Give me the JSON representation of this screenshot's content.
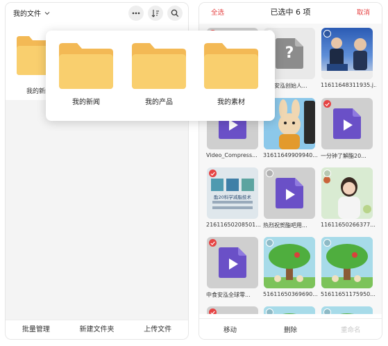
{
  "left_panel": {
    "title": "我的文件",
    "folder_label": "我的新闻",
    "bottom": [
      "批量管理",
      "新建文件夹",
      "上传文件"
    ]
  },
  "popup": {
    "folders": [
      "我的新闻",
      "我的产品",
      "我的素材"
    ]
  },
  "right_panel": {
    "select_all": "全选",
    "title": "已选中 6 项",
    "cancel": "取消",
    "tiles": [
      {
        "label": "",
        "kind": "video",
        "checked": true
      },
      {
        "label": "中食安泓创始人...",
        "kind": "unknown",
        "checked": false
      },
      {
        "label": "1161164831193​5.j...",
        "kind": "photo-conference",
        "checked": false
      },
      {
        "label": "Video_Compress...",
        "kind": "video",
        "checked": true
      },
      {
        "label": "3161164990994​0...",
        "kind": "photo-rabbit",
        "checked": false
      },
      {
        "label": "一分钟了解酯20...",
        "kind": "video",
        "checked": true
      },
      {
        "label": "2161165020850​1...",
        "kind": "photo-text",
        "checked": true
      },
      {
        "label": "热烈祝贺酯吧用...",
        "kind": "video",
        "checked": false
      },
      {
        "label": "1161165026637​7...",
        "kind": "photo-woman",
        "checked": false
      },
      {
        "label": "中食安泓全球零...",
        "kind": "video",
        "checked": true
      },
      {
        "label": "5161165036969​0...",
        "kind": "photo-tree",
        "checked": false
      },
      {
        "label": "5161165117595​0...",
        "kind": "photo-tree",
        "checked": false
      },
      {
        "label": "",
        "kind": "video",
        "checked": true
      },
      {
        "label": "",
        "kind": "photo-tree",
        "checked": false
      },
      {
        "label": "",
        "kind": "photo-tree",
        "checked": false
      }
    ],
    "image_text": {
      "unknown_glyph": "?",
      "photo_text_title": "酯20科学减脂技术"
    },
    "bottom": [
      {
        "label": "移动",
        "disabled": false
      },
      {
        "label": "删除",
        "disabled": false
      },
      {
        "label": "重命名",
        "disabled": true
      }
    ]
  },
  "colors": {
    "accent_red": "#e64444",
    "folder_front": "#f9cf6e",
    "folder_back": "#f3b955",
    "video_purple": "#6a50c7"
  }
}
